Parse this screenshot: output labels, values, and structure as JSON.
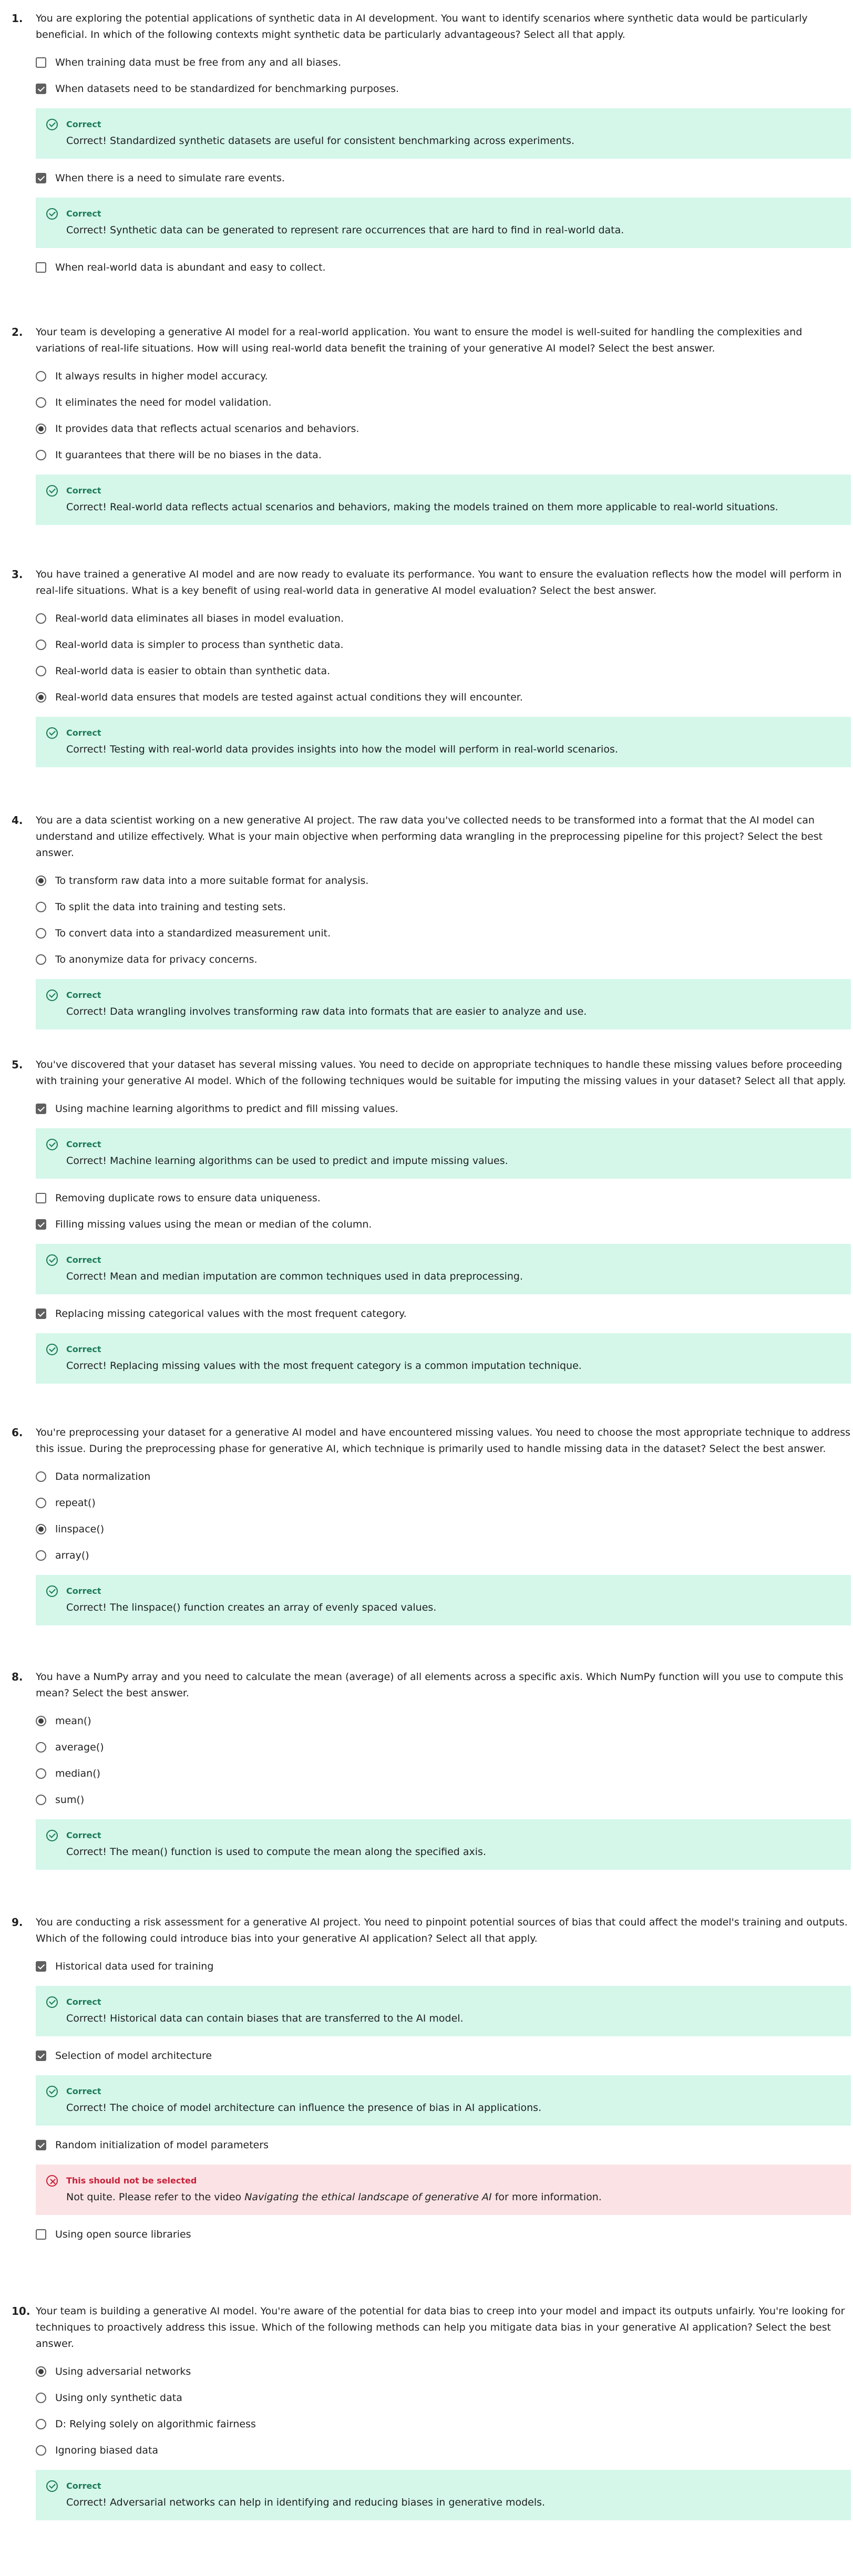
{
  "feedback_labels": {
    "correct": "Correct",
    "wrong": "This should not be selected"
  },
  "colors": {
    "correct_bg": "#d4f7ea",
    "correct_accent": "#1b7a56",
    "wrong_bg": "#fbe3e5",
    "wrong_accent": "#c8213a",
    "control": "#5f5f5f"
  },
  "icons": {
    "correct": "check-circle-icon",
    "wrong": "x-circle-icon",
    "checkbox": "checkbox-icon",
    "radio": "radio-icon"
  },
  "questions": [
    {
      "number": "1.",
      "type": "checkbox",
      "text": "You are exploring the potential applications of synthetic data in AI development. You want to identify scenarios where synthetic data would be particularly beneficial. In which of the following contexts might synthetic data be particularly advantageous? Select all that apply.",
      "items": [
        {
          "kind": "option",
          "label": "When training data must be free from any and all biases.",
          "checked": false
        },
        {
          "kind": "option",
          "label": "When datasets need to be standardized for benchmarking purposes.",
          "checked": true
        },
        {
          "kind": "feedback",
          "status": "correct",
          "text": "Correct! Standardized synthetic datasets are useful for consistent benchmarking across experiments."
        },
        {
          "kind": "option",
          "label": "When there is a need to simulate rare events.",
          "checked": true
        },
        {
          "kind": "feedback",
          "status": "correct",
          "text": "Correct! Synthetic data can be generated to represent rare occurrences that are hard to find in real-world data."
        },
        {
          "kind": "option",
          "label": "When real-world data is abundant and easy to collect.",
          "checked": false
        }
      ]
    },
    {
      "number": "2.",
      "type": "radio",
      "text": "Your team is developing a generative AI model for a real-world application. You want to ensure the model is well-suited for handling the complexities and variations of real-life situations. How will using real-world data benefit the training of your generative AI model? Select the best answer.",
      "items": [
        {
          "kind": "option",
          "label": "It always results in higher model accuracy.",
          "checked": false
        },
        {
          "kind": "option",
          "label": "It eliminates the need for model validation.",
          "checked": false
        },
        {
          "kind": "option",
          "label": "It provides data that reflects actual scenarios and behaviors.",
          "checked": true
        },
        {
          "kind": "option",
          "label": "It guarantees that there will be no biases in the data.",
          "checked": false
        },
        {
          "kind": "feedback",
          "status": "correct",
          "text": "Correct! Real-world data reflects actual scenarios and behaviors, making the models trained on them more applicable to real-world situations."
        }
      ]
    },
    {
      "number": "3.",
      "type": "radio",
      "text": "You have trained a generative AI model and are now ready to evaluate its performance. You want to ensure the evaluation reflects how the model will perform in real-life situations. What is a key benefit of using real-world data in generative AI model evaluation? Select the best answer.",
      "items": [
        {
          "kind": "option",
          "label": "Real-world data eliminates all biases in model evaluation.",
          "checked": false
        },
        {
          "kind": "option",
          "label": "Real-world data is simpler to process than synthetic data.",
          "checked": false
        },
        {
          "kind": "option",
          "label": "Real-world data is easier to obtain than synthetic data.",
          "checked": false
        },
        {
          "kind": "option",
          "label": "Real-world data ensures that models are tested against actual conditions they will encounter.",
          "checked": true
        },
        {
          "kind": "feedback",
          "status": "correct",
          "text": "Correct! Testing with real-world data provides insights into how the model will perform in real-world scenarios."
        }
      ]
    },
    {
      "number": "4.",
      "type": "radio",
      "text": "You are a data scientist working on a new generative AI project. The raw data you've collected needs to be transformed into a format that the AI model can understand and utilize effectively. What is your main objective when performing data wrangling in the preprocessing pipeline for this project? Select the best answer.",
      "items": [
        {
          "kind": "option",
          "label": "To transform raw data into a more suitable format for analysis.",
          "checked": true
        },
        {
          "kind": "option",
          "label": "To split the data into training and testing sets.",
          "checked": false
        },
        {
          "kind": "option",
          "label": "To convert data into a standardized measurement unit.",
          "checked": false
        },
        {
          "kind": "option",
          "label": "To anonymize data for privacy concerns.",
          "checked": false
        },
        {
          "kind": "feedback",
          "status": "correct",
          "text": "Correct! Data wrangling involves transforming raw data into formats that are easier to analyze and use."
        }
      ]
    },
    {
      "number": "5.",
      "type": "checkbox",
      "text": "You've discovered that your dataset has several missing values. You need to decide on appropriate techniques to handle these missing values before proceeding with training your generative AI model. Which of the following techniques would be suitable for imputing the missing values in your dataset? Select all that apply.",
      "items": [
        {
          "kind": "option",
          "label": "Using machine learning algorithms to predict and fill missing values.",
          "checked": true
        },
        {
          "kind": "feedback",
          "status": "correct",
          "text": "Correct! Machine learning algorithms can be used to predict and impute missing values."
        },
        {
          "kind": "option",
          "label": "Removing duplicate rows to ensure data uniqueness.",
          "checked": false
        },
        {
          "kind": "option",
          "label": "Filling missing values using the mean or median of the column.",
          "checked": true
        },
        {
          "kind": "feedback",
          "status": "correct",
          "text": "Correct! Mean and median imputation are common techniques used in data preprocessing."
        },
        {
          "kind": "option",
          "label": "Replacing missing categorical values with the most frequent category.",
          "checked": true
        },
        {
          "kind": "feedback",
          "status": "correct",
          "text": "Correct! Replacing missing values with the most frequent category is a common imputation technique."
        }
      ]
    },
    {
      "number": "6.",
      "type": "radio",
      "text": "You're preprocessing your dataset for a generative AI model and have encountered missing values. You need to choose the most appropriate technique to address this issue. During the preprocessing phase for generative AI, which technique is primarily used to handle missing data in the dataset? Select the best answer.",
      "items": [
        {
          "kind": "option",
          "label": "Data normalization",
          "checked": false
        },
        {
          "kind": "option",
          "label": "repeat()",
          "checked": false
        },
        {
          "kind": "option",
          "label": "linspace()",
          "checked": true
        },
        {
          "kind": "option",
          "label": "array()",
          "checked": false
        },
        {
          "kind": "feedback",
          "status": "correct",
          "text": "Correct! The linspace() function creates an array of evenly spaced values."
        }
      ]
    },
    {
      "number": "8.",
      "type": "radio",
      "text": "You have a NumPy array and you need to calculate the mean (average) of all elements across a specific axis. Which NumPy function will you use to compute this mean? Select the best answer.",
      "items": [
        {
          "kind": "option",
          "label": "mean()",
          "checked": true
        },
        {
          "kind": "option",
          "label": "average()",
          "checked": false
        },
        {
          "kind": "option",
          "label": "median()",
          "checked": false
        },
        {
          "kind": "option",
          "label": "sum()",
          "checked": false
        },
        {
          "kind": "feedback",
          "status": "correct",
          "text": "Correct! The mean() function is used to compute the mean along the specified axis."
        }
      ]
    },
    {
      "number": "9.",
      "type": "checkbox",
      "text": "You are conducting a risk assessment for a generative AI project. You need to pinpoint potential sources of bias that could affect the model's training and outputs. Which of the following could introduce bias into your generative AI application? Select all that apply.",
      "items": [
        {
          "kind": "option",
          "label": "Historical data used for training",
          "checked": true
        },
        {
          "kind": "feedback",
          "status": "correct",
          "text": "Correct! Historical data can contain biases that are transferred to the AI model."
        },
        {
          "kind": "option",
          "label": "Selection of model architecture",
          "checked": true
        },
        {
          "kind": "feedback",
          "status": "correct",
          "text": "Correct! The choice of model architecture can influence the presence of bias in AI applications."
        },
        {
          "kind": "option",
          "label": "Random initialization of model parameters",
          "checked": true
        },
        {
          "kind": "feedback",
          "status": "wrong",
          "text_before": "Not quite. Please refer to the video ",
          "text_italic": "Navigating the ethical landscape of generative AI",
          "text_after": " for more information."
        },
        {
          "kind": "option",
          "label": "Using open source libraries",
          "checked": false
        }
      ]
    },
    {
      "number": "10.",
      "type": "radio",
      "text": "Your team is building a generative AI model. You're aware of the potential for data bias to creep into your model and impact its outputs unfairly. You're looking for techniques to proactively address this issue. Which of the following methods can help you mitigate data bias in your generative AI application? Select the best answer.",
      "items": [
        {
          "kind": "option",
          "label": "Using adversarial networks",
          "checked": true
        },
        {
          "kind": "option",
          "label": "Using only synthetic data",
          "checked": false
        },
        {
          "kind": "option",
          "label": "D: Relying solely on algorithmic fairness",
          "checked": false
        },
        {
          "kind": "option",
          "label": "Ignoring biased data",
          "checked": false
        },
        {
          "kind": "feedback",
          "status": "correct",
          "text": "Correct! Adversarial networks can help in identifying and reducing biases in generative models."
        }
      ]
    }
  ]
}
